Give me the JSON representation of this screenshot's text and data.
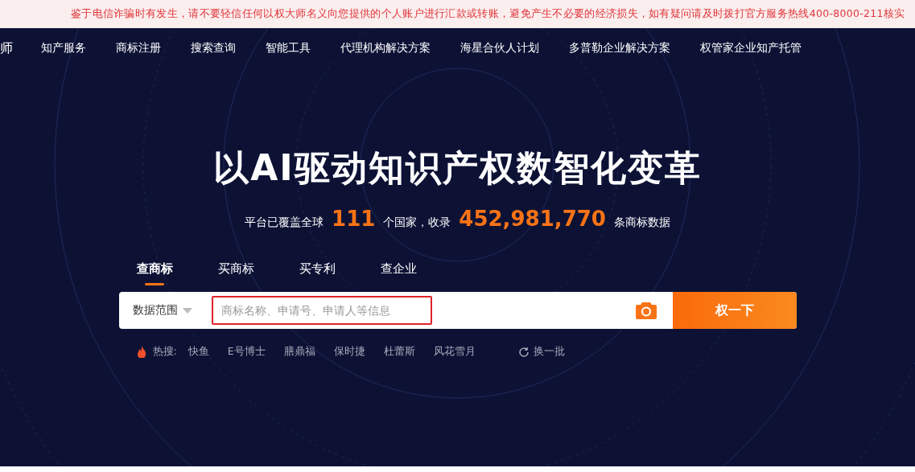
{
  "notice": {
    "text": "鉴于电信诈骗时有发生，请不要轻信任何以权大师名义向您提供的个人账户进行汇款或转账，避免产生不必要的经济损失，如有疑问请及时拨打官方服务热线400-8000-211核实"
  },
  "nav": {
    "logo": "师",
    "items": [
      "知产服务",
      "商标注册",
      "搜索查询",
      "智能工具",
      "代理机构解决方案",
      "海星合伙人计划",
      "多普勒企业解决方案",
      "权管家企业知产托管"
    ]
  },
  "hero": {
    "title": "以AI驱动知识产权数智化变革",
    "stats": [
      {
        "kind": "text",
        "text": "平台已覆盖全球"
      },
      {
        "kind": "number",
        "text": "111"
      },
      {
        "kind": "text",
        "text": "个国家，收录"
      },
      {
        "kind": "number",
        "text": "452,981,770"
      },
      {
        "kind": "text",
        "text": "条商标数据"
      }
    ]
  },
  "search": {
    "tabs": [
      {
        "label": "查商标",
        "selected": true
      },
      {
        "label": "买商标",
        "selected": false
      },
      {
        "label": "买专利",
        "selected": false
      },
      {
        "label": "查企业",
        "selected": false
      }
    ],
    "scope": "数据范围",
    "placeholder": "商标名称、申请号、申请人等信息",
    "highlighted": true,
    "button": "权一下"
  },
  "hot": {
    "label": "热搜:",
    "items": [
      "快鱼",
      "E号博士",
      "膳鼎福",
      "保时捷",
      "杜蕾斯",
      "风花雪月"
    ],
    "refresh": "换一批"
  }
}
